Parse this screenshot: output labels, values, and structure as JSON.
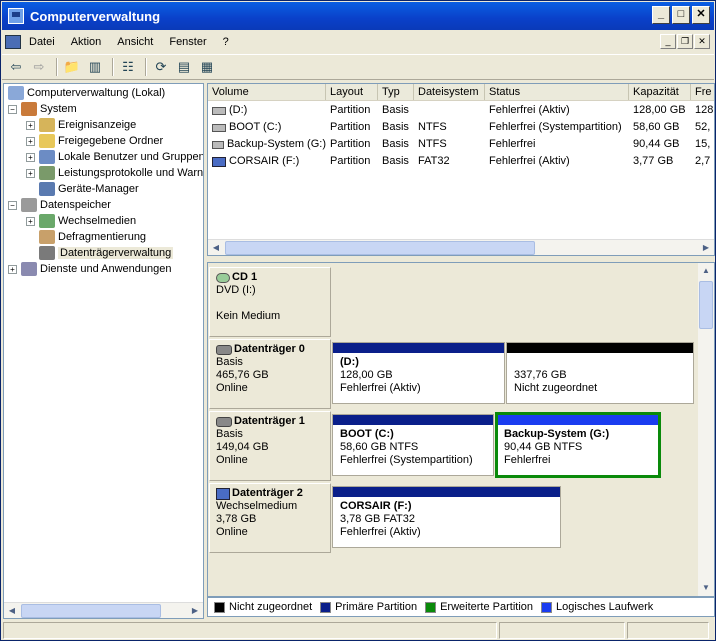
{
  "window": {
    "title": "Computerverwaltung"
  },
  "menu": {
    "items": [
      "Datei",
      "Aktion",
      "Ansicht",
      "Fenster",
      "?"
    ]
  },
  "tree": {
    "root": "Computerverwaltung (Lokal)",
    "system": "System",
    "ereignis": "Ereignisanzeige",
    "ordner": "Freigegebene Ordner",
    "benutzer": "Lokale Benutzer und Gruppen",
    "leistung": "Leistungsprotokolle und Warn",
    "geraete": "Geräte-Manager",
    "datenspeicher": "Datenspeicher",
    "wechsel": "Wechselmedien",
    "defrag": "Defragmentierung",
    "dtv": "Datenträgerverwaltung",
    "dienste": "Dienste und Anwendungen"
  },
  "volumes": {
    "columns": [
      "Volume",
      "Layout",
      "Typ",
      "Dateisystem",
      "Status",
      "Kapazität",
      "Fre"
    ],
    "rows": [
      [
        "(D:)",
        "Partition",
        "Basis",
        "",
        "Fehlerfrei (Aktiv)",
        "128,00 GB",
        "128"
      ],
      [
        "BOOT (C:)",
        "Partition",
        "Basis",
        "NTFS",
        "Fehlerfrei (Systempartition)",
        "58,60 GB",
        "52,"
      ],
      [
        "Backup-System (G:)",
        "Partition",
        "Basis",
        "NTFS",
        "Fehlerfrei",
        "90,44 GB",
        "15,"
      ],
      [
        "CORSAIR (F:)",
        "Partition",
        "Basis",
        "FAT32",
        "Fehlerfrei (Aktiv)",
        "3,77 GB",
        "2,7"
      ]
    ]
  },
  "disks": [
    {
      "name": "CD 1",
      "l1": "DVD (I:)",
      "l2": "",
      "l3": "Kein Medium"
    },
    {
      "name": "Datenträger 0",
      "l1": "Basis",
      "l2": "465,76 GB",
      "l3": "Online"
    },
    {
      "name": "Datenträger 1",
      "l1": "Basis",
      "l2": "149,04 GB",
      "l3": "Online"
    },
    {
      "name": "Datenträger 2",
      "l1": "Wechselmedium",
      "l2": "3,78 GB",
      "l3": "Online"
    }
  ],
  "partitions": {
    "d": {
      "name": "(D:)",
      "size": "128,00 GB",
      "status": "Fehlerfrei (Aktiv)"
    },
    "unalloc": {
      "name": "",
      "size": "337,76 GB",
      "status": "Nicht zugeordnet"
    },
    "c": {
      "name": "BOOT  (C:)",
      "size": "58,60 GB NTFS",
      "status": "Fehlerfrei (Systempartition)"
    },
    "g": {
      "name": "Backup-System  (G:)",
      "size": "90,44 GB NTFS",
      "status": "Fehlerfrei"
    },
    "f": {
      "name": "CORSAIR  (F:)",
      "size": "3,78 GB FAT32",
      "status": "Fehlerfrei (Aktiv)"
    }
  },
  "legend": {
    "unalloc": "Nicht zugeordnet",
    "primary": "Primäre Partition",
    "extended": "Erweiterte Partition",
    "logical": "Logisches Laufwerk"
  },
  "colors": {
    "unalloc": "#000000",
    "primary": "#0a1f8a",
    "extended": "#0a8a0a",
    "logical": "#1a3cf0"
  }
}
